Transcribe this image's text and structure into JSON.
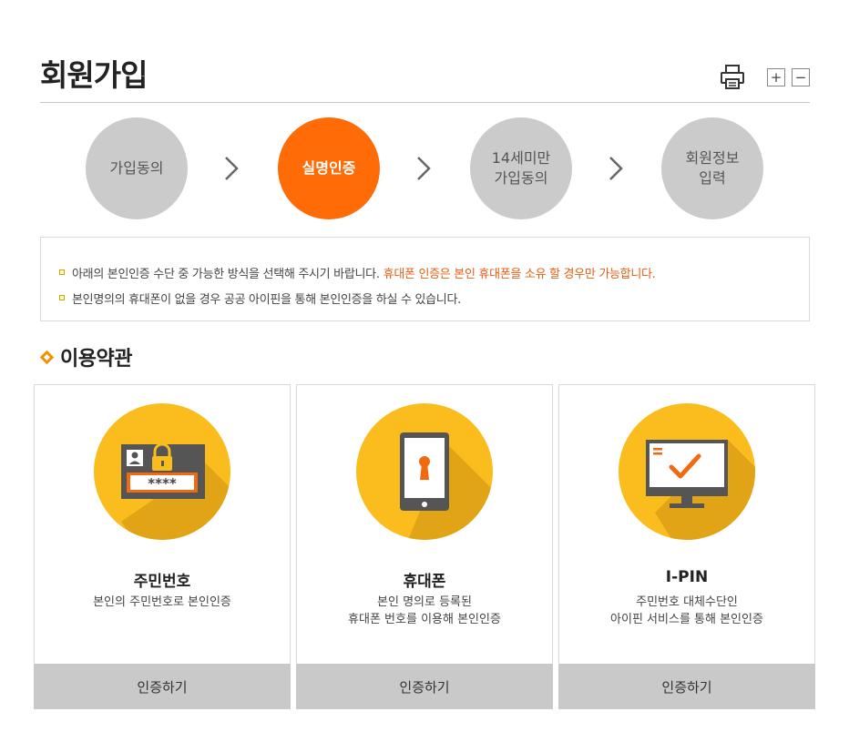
{
  "header": {
    "title": "회원가입",
    "zoom_in": "+",
    "zoom_out": "−"
  },
  "steps": [
    {
      "label": "가입동의",
      "active": false
    },
    {
      "label": "실명인증",
      "active": true
    },
    {
      "label": "14세미만\n가입동의",
      "active": false
    },
    {
      "label": "회원정보\n입력",
      "active": false
    }
  ],
  "notice": {
    "line1": "아래의 본인인증 수단 중 가능한 방식을 선택해 주시기 바랍니다.",
    "line1_highlight": "휴대폰 인증은 본인 휴대폰을 소유 할 경우만 가능합니다.",
    "line2": "본인명의의 휴대폰이 없을 경우 공공 아이핀을 통해 본인인증을 하실 수 있습니다."
  },
  "section": {
    "title": "이용약관"
  },
  "cards": [
    {
      "title": "주민번호",
      "desc": "본인의 주민번호로 본인인증",
      "button": "인증하기",
      "icon": "id-card-lock-icon"
    },
    {
      "title": "휴대폰",
      "desc": "본인 명의로 등록된\n휴대폰 번호를 이용해 본인인증",
      "button": "인증하기",
      "icon": "mobile-lock-icon"
    },
    {
      "title": "I-PIN",
      "desc": "주민번호 대체수단인\n아이핀 서비스를 통해 본인인증",
      "button": "인증하기",
      "icon": "monitor-check-icon"
    }
  ],
  "colors": {
    "accent": "#ff6b07",
    "highlight": "#ea5d14",
    "icon_circle": "#fbbc1d",
    "inactive_step": "#cbcbcb",
    "button_bg": "#c9c9c9"
  }
}
